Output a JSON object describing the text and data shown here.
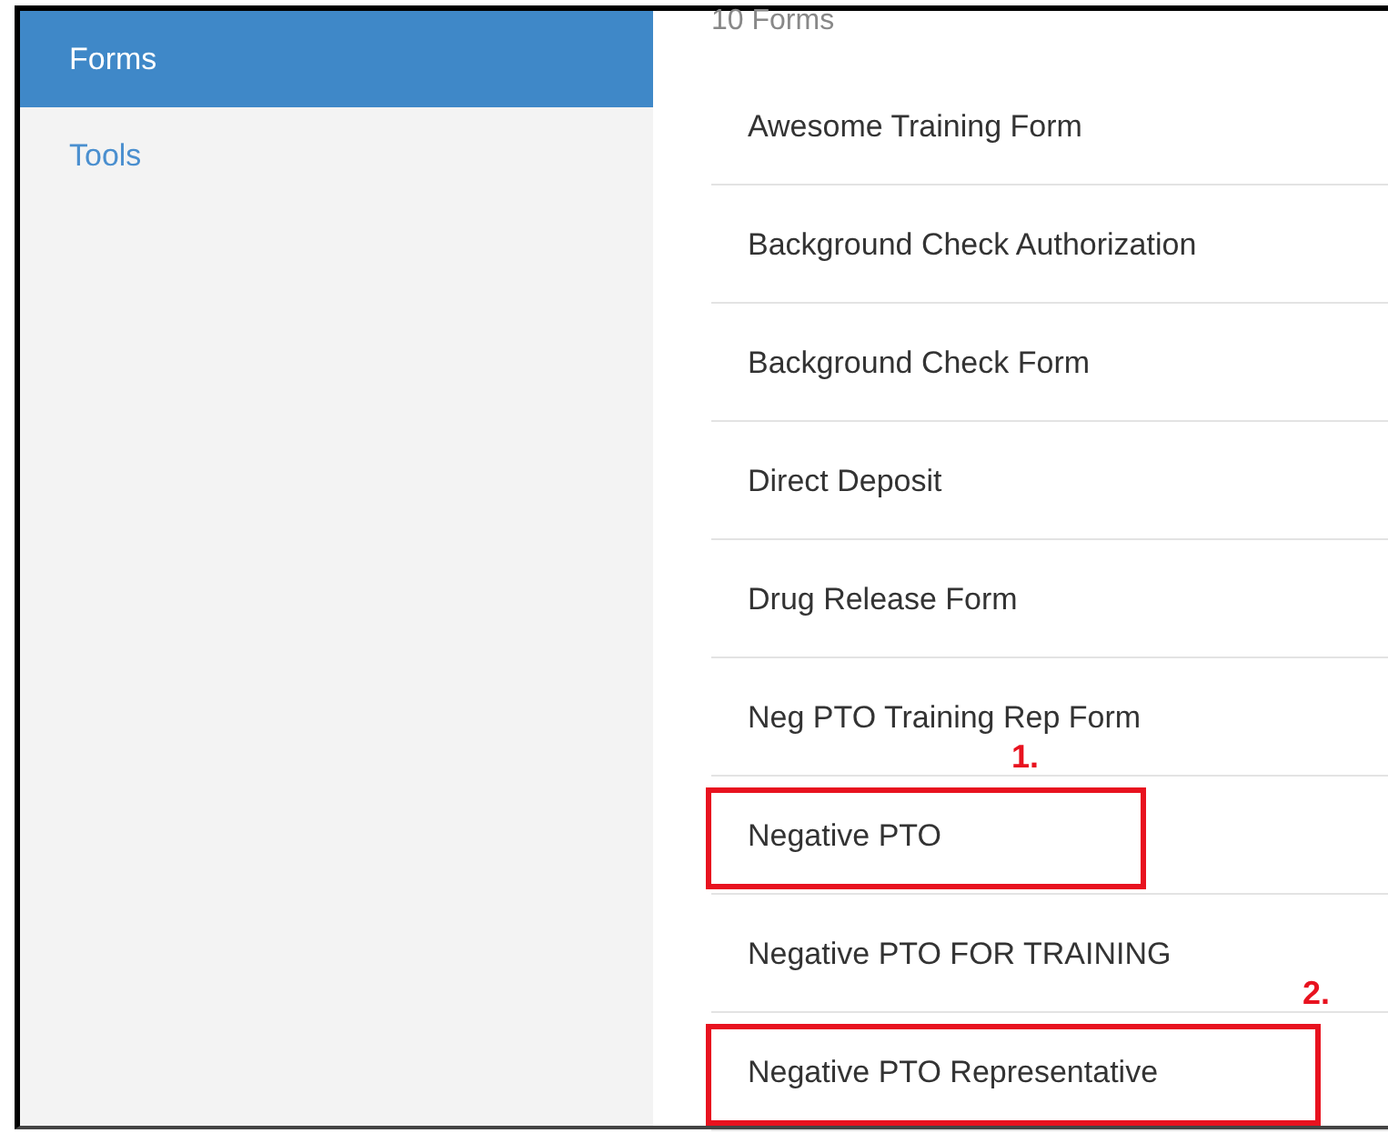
{
  "sidebar": {
    "items": [
      {
        "label": "Forms",
        "selected": true
      },
      {
        "label": "Tools",
        "selected": false
      }
    ]
  },
  "forms": {
    "count": "10 Forms",
    "items": [
      {
        "label": "Awesome Training Form"
      },
      {
        "label": "Background Check Authorization"
      },
      {
        "label": "Background Check Form"
      },
      {
        "label": "Direct Deposit"
      },
      {
        "label": "Drug Release Form"
      },
      {
        "label": "Neg PTO Training Rep Form"
      },
      {
        "label": "Negative PTO",
        "callout": "1."
      },
      {
        "label": "Negative PTO FOR TRAINING"
      },
      {
        "label": "Negative PTO Representative",
        "callout": "2."
      }
    ]
  }
}
